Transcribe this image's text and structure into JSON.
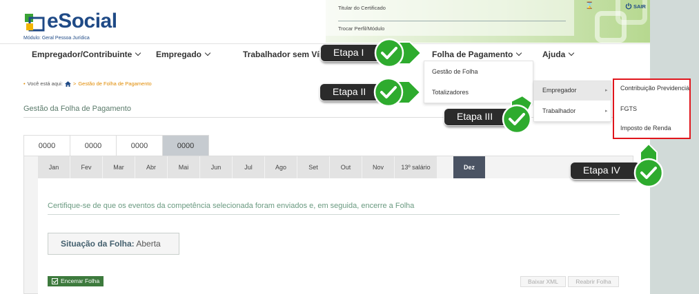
{
  "header": {
    "logo_text": "eSocial",
    "logo_subtitle": "Módulo: Geral Pessoa Jurídica",
    "certificate_label": "Titular do Certificado",
    "change_profile_label": "Trocar Perfil/Módulo",
    "logout_label": "SAIR"
  },
  "nav": {
    "items": [
      {
        "label": "Empregador/Contribuinte"
      },
      {
        "label": "Empregado"
      },
      {
        "label": "Trabalhador sem Vínc"
      },
      {
        "label": "Folha de Pagamento"
      },
      {
        "label": "Ajuda"
      }
    ]
  },
  "dropdown_folha": {
    "items": [
      {
        "label": "Gestão de Folha"
      },
      {
        "label": "Totalizadores"
      }
    ]
  },
  "dropdown_totalizadores": {
    "items": [
      {
        "label": "Empregador"
      },
      {
        "label": "Trabalhador"
      }
    ]
  },
  "dropdown_empregador": {
    "items": [
      {
        "label": "Contribuição Previdenciária"
      },
      {
        "label": "FGTS"
      },
      {
        "label": "Imposto de Renda"
      }
    ]
  },
  "breadcrumb": {
    "prefix": "Você está aqui:",
    "sep": ">",
    "current": "Gestão de Folha de Pagamento"
  },
  "page_title": "Gestão da Folha de Pagamento",
  "year_tabs": {
    "items": [
      {
        "label": "0000"
      },
      {
        "label": "0000"
      },
      {
        "label": "0000"
      },
      {
        "label": "0000"
      }
    ],
    "active_index": 3
  },
  "months": {
    "items": [
      {
        "label": "Jan"
      },
      {
        "label": "Fev"
      },
      {
        "label": "Mar"
      },
      {
        "label": "Abr"
      },
      {
        "label": "Mai"
      },
      {
        "label": "Jun"
      },
      {
        "label": "Jul"
      },
      {
        "label": "Ago"
      },
      {
        "label": "Set"
      },
      {
        "label": "Out"
      },
      {
        "label": "Nov"
      },
      {
        "label": "13º salário"
      },
      {
        "label": "Dez"
      }
    ],
    "active_index": 12
  },
  "instruction": "Certifique-se de que os eventos da competência selecionada foram enviados e, em seguida, encerre a Folha",
  "situacao": {
    "label": "Situação da Folha:",
    "value": "Aberta"
  },
  "buttons": {
    "encerrar": "Encerrar Folha",
    "baixar_xml": "Baixar XML",
    "reabrir": "Reabrir Folha"
  },
  "etapas": [
    {
      "label": "Etapa I"
    },
    {
      "label": "Etapa II"
    },
    {
      "label": "Etapa III"
    },
    {
      "label": "Etapa IV"
    }
  ],
  "colors": {
    "brand_blue": "#1f4a86",
    "accent_orange": "#e08a00",
    "highlight_red": "#e0141b",
    "check_green": "#2eab2e",
    "encerrar_green": "#3d7a3d",
    "active_month": "#4a5363"
  }
}
